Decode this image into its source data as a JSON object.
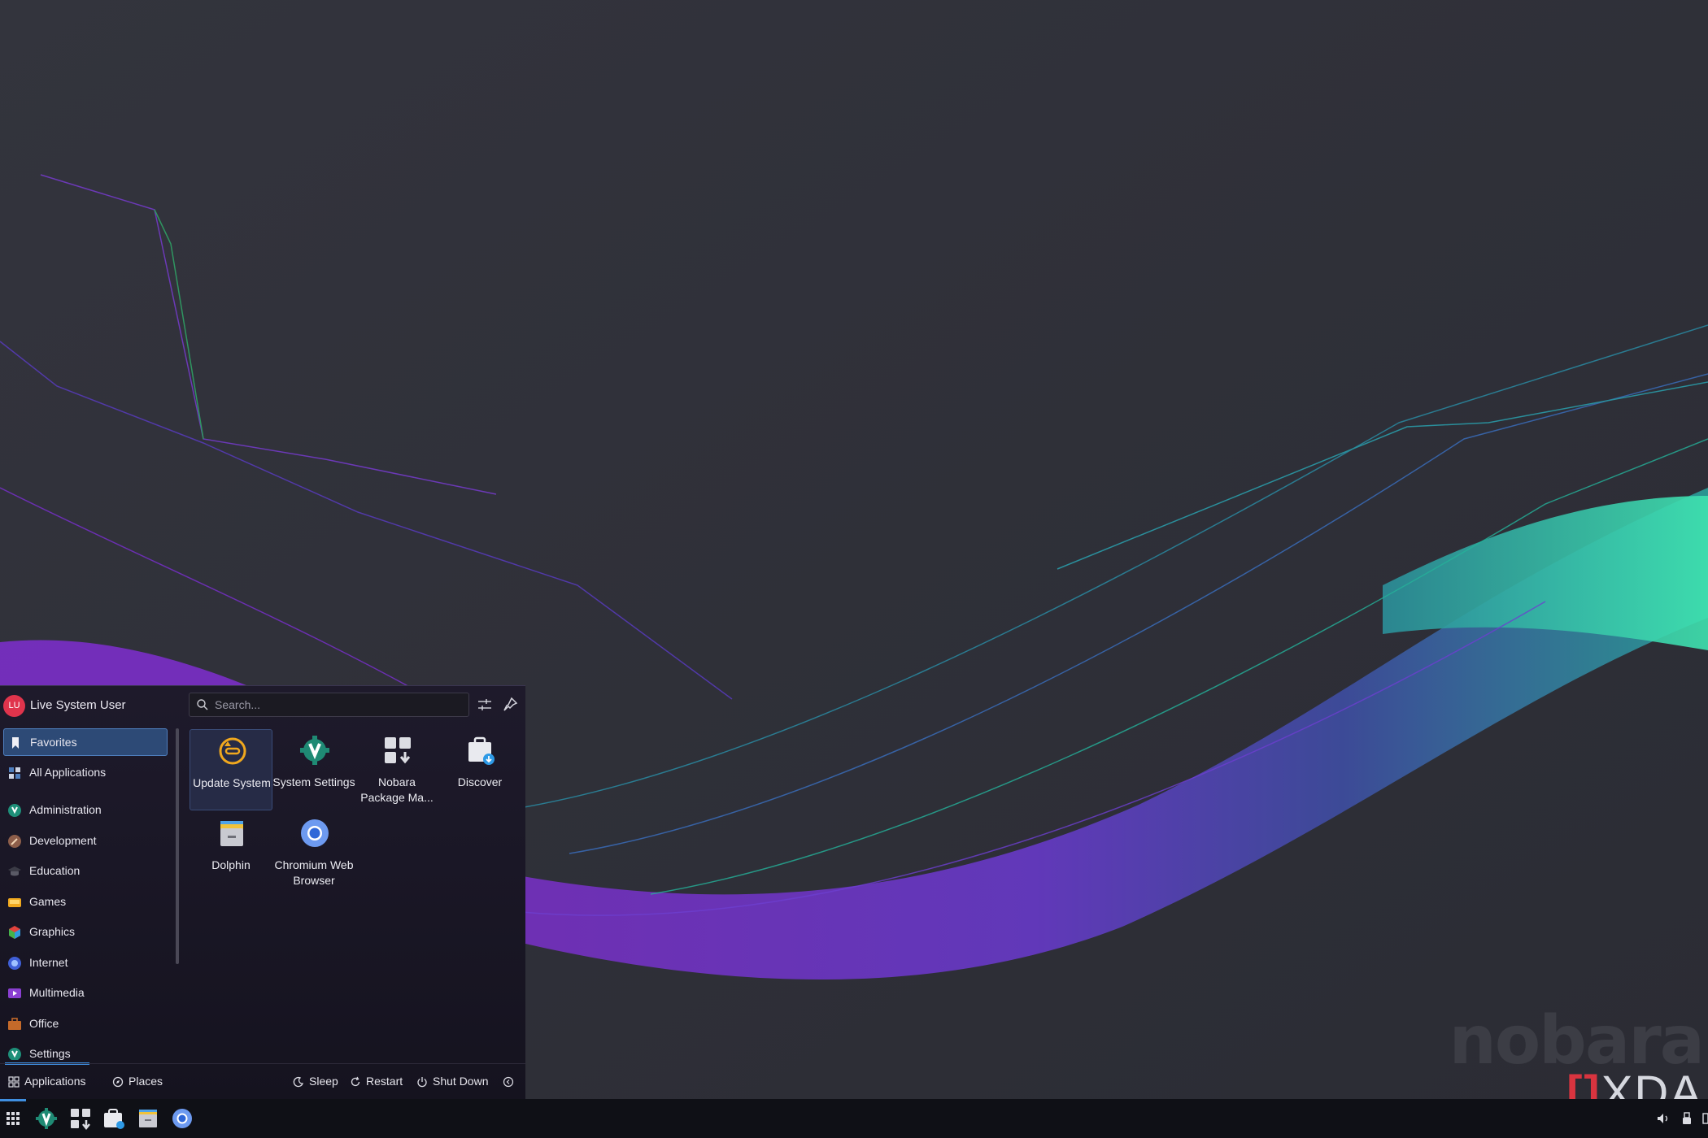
{
  "launcher": {
    "user": {
      "initials": "LU",
      "name": "Live System User"
    },
    "search": {
      "placeholder": "Search..."
    },
    "categories": [
      {
        "label": "Favorites",
        "icon": "bookmark-icon",
        "active": true
      },
      {
        "label": "All Applications",
        "icon": "grid-icon"
      },
      {
        "label": "Administration",
        "icon": "administration-icon"
      },
      {
        "label": "Development",
        "icon": "development-icon"
      },
      {
        "label": "Education",
        "icon": "education-icon"
      },
      {
        "label": "Games",
        "icon": "games-icon"
      },
      {
        "label": "Graphics",
        "icon": "graphics-icon"
      },
      {
        "label": "Internet",
        "icon": "internet-icon"
      },
      {
        "label": "Multimedia",
        "icon": "multimedia-icon"
      },
      {
        "label": "Office",
        "icon": "office-icon"
      },
      {
        "label": "Settings",
        "icon": "settings-icon"
      }
    ],
    "favorites": [
      {
        "label": "Update System",
        "icon": "update-system-icon"
      },
      {
        "label": "System Settings",
        "icon": "system-settings-icon"
      },
      {
        "label": "Nobara Package Ma...",
        "icon": "package-manager-icon"
      },
      {
        "label": "Discover",
        "icon": "discover-icon"
      },
      {
        "label": "Dolphin",
        "icon": "dolphin-icon"
      },
      {
        "label": "Chromium Web Browser",
        "icon": "chromium-icon"
      }
    ],
    "footer": {
      "applications": "Applications",
      "places": "Places",
      "sleep": "Sleep",
      "restart": "Restart",
      "shutdown": "Shut Down"
    }
  },
  "watermark": {
    "nobara": "nobara",
    "xda": "XDA"
  },
  "colors": {
    "accent": "#3f8fe0",
    "panel": "#1b1826",
    "taskbar": "#0f1016",
    "avatar": "#e0344c"
  }
}
